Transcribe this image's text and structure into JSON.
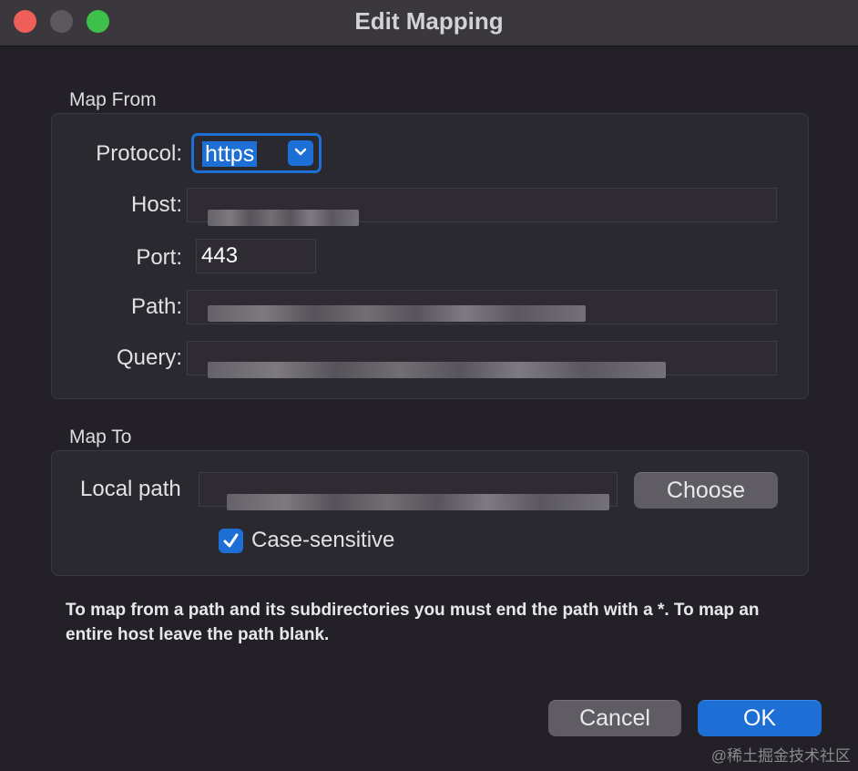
{
  "window": {
    "title": "Edit Mapping"
  },
  "map_from": {
    "group_label": "Map From",
    "protocol_label": "Protocol:",
    "protocol_value": "https",
    "host_label": "Host:",
    "host_value": "",
    "port_label": "Port:",
    "port_value": "443",
    "path_label": "Path:",
    "path_value": "",
    "query_label": "Query:",
    "query_value": ""
  },
  "map_to": {
    "group_label": "Map To",
    "local_path_label": "Local path",
    "local_path_value": "",
    "choose_button": "Choose",
    "case_sensitive_label": "Case-sensitive",
    "case_sensitive_checked": true
  },
  "help_text": "To map from a path and its subdirectories you must end the path with a *. To map an entire host leave the path blank.",
  "buttons": {
    "cancel": "Cancel",
    "ok": "OK"
  },
  "watermark": "@稀土掘金技术社区",
  "colors": {
    "accent": "#1d6fd6",
    "close": "#ed5f58",
    "maximize": "#3ec14b"
  }
}
